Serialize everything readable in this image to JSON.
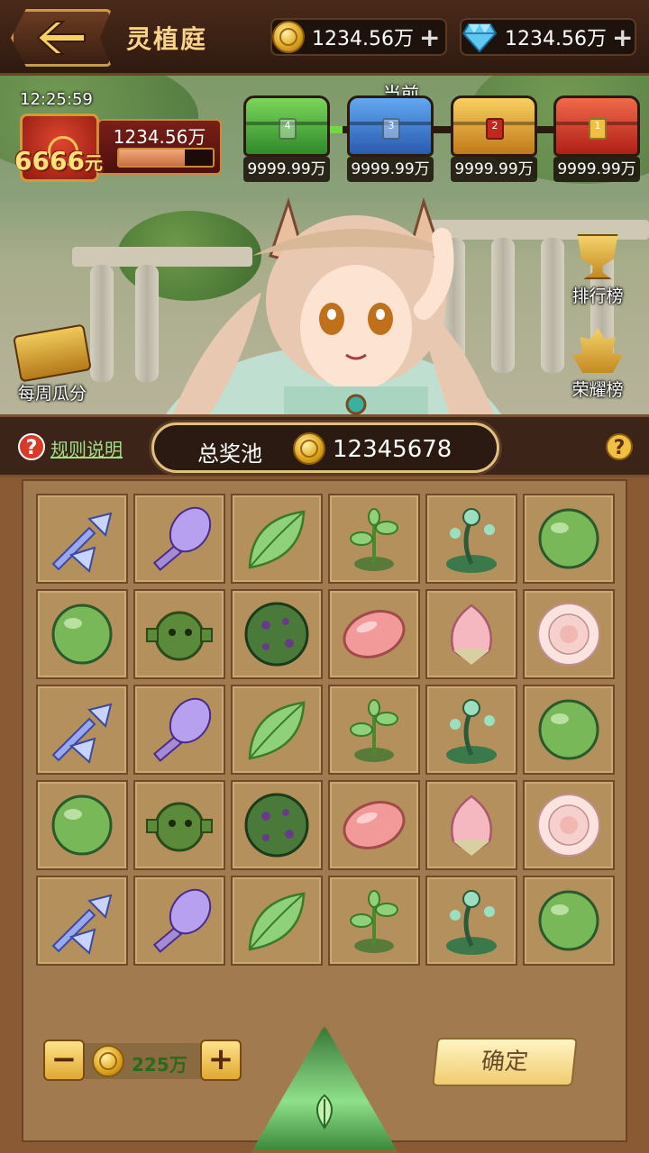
{
  "header": {
    "title": "灵植庭",
    "gold": {
      "amount": "1234.56万",
      "plus": "+"
    },
    "diamond": {
      "amount": "1234.56万",
      "plus": "+"
    }
  },
  "event": {
    "timer": "12:25:59",
    "bag_amount": "6666",
    "bag_unit": "元",
    "bag_value": "1234.56万",
    "bag_progress": 0.7,
    "current_label": "当前",
    "chests": [
      {
        "level": "4",
        "color": "green",
        "value": "9999.99万"
      },
      {
        "level": "3",
        "color": "blue",
        "value": "9999.99万"
      },
      {
        "level": "2",
        "color": "gold",
        "value": "9999.99万"
      },
      {
        "level": "1",
        "color": "red",
        "value": "9999.99万"
      }
    ],
    "rank_label": "排行榜",
    "honor_label": "荣耀榜",
    "weekly_label": "每周瓜分"
  },
  "prize": {
    "rules_label": "规则说明",
    "pool_label": "总奖池",
    "pool_value": "12345678",
    "help_glyph": "?"
  },
  "board": {
    "rows": [
      [
        "crystal-arrows",
        "crystal-mace",
        "leaf",
        "sprout",
        "vine",
        "green-orb"
      ],
      [
        "green-orb",
        "cannon",
        "moss-ball",
        "pink-seed",
        "pink-bud",
        "white-rose"
      ],
      [
        "crystal-arrows",
        "crystal-mace",
        "leaf",
        "sprout",
        "vine",
        "green-orb"
      ],
      [
        "green-orb",
        "cannon",
        "moss-ball",
        "pink-seed",
        "pink-bud",
        "white-rose"
      ],
      [
        "crystal-arrows",
        "crystal-mace",
        "leaf",
        "sprout",
        "vine",
        "green-orb"
      ]
    ]
  },
  "controls": {
    "minus": "−",
    "plus": "+",
    "bet": "225万",
    "confirm": "确定"
  },
  "colors": {
    "accent_gold": "#f7d48a",
    "link_green": "#9ee08a",
    "bet_green": "#2a6a1a"
  }
}
